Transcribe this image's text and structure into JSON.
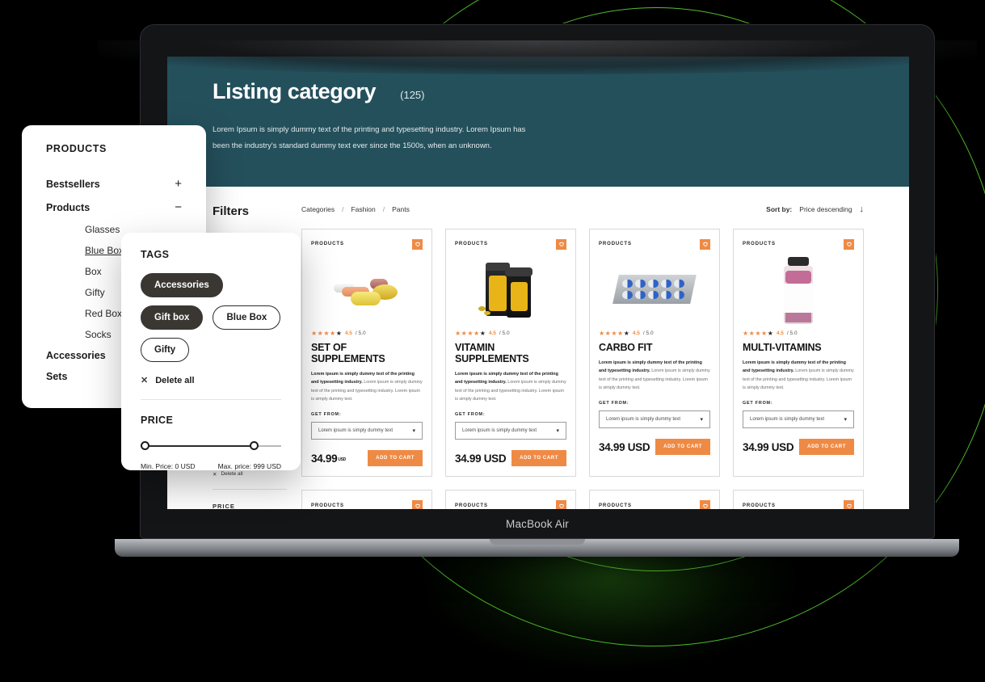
{
  "device": {
    "model_label": "MacBook Air"
  },
  "hero": {
    "title": "Listing category",
    "count": "(125)",
    "description_line1": "Lorem Ipsum is simply dummy text of the printing and typesetting industry. Lorem Ipsum has",
    "description_line2": "been the industry's standard dummy text ever since the 1500s, when an unknown.",
    "bg_color": "#24505c"
  },
  "filters_column": {
    "title": "Filters",
    "section_label": "PRODUCTS",
    "ghost_delete_all": "Delete all",
    "ghost_price_label": "PRICE"
  },
  "toolbar": {
    "breadcrumbs": [
      "Categories",
      "Fashion",
      "Pants"
    ],
    "separator": "/",
    "sort_label": "Sort by:",
    "sort_value": "Price descending",
    "sort_direction_icon": "↓"
  },
  "products_panel": {
    "title": "PRODUCTS",
    "items": [
      {
        "label": "Bestsellers",
        "sign": "+",
        "level": "top"
      },
      {
        "label": "Products",
        "sign": "−",
        "level": "top"
      },
      {
        "label": "Glasses",
        "level": "sub"
      },
      {
        "label": "Blue Box",
        "level": "sub",
        "active": true
      },
      {
        "label": "Box",
        "level": "sub"
      },
      {
        "label": "Gifty",
        "level": "sub"
      },
      {
        "label": "Red Box",
        "level": "sub"
      },
      {
        "label": "Socks",
        "level": "sub"
      },
      {
        "label": "Accessories",
        "level": "top"
      },
      {
        "label": "Sets",
        "level": "top"
      }
    ]
  },
  "tags_panel": {
    "title": "TAGS",
    "chips": [
      {
        "label": "Accessories",
        "selected": true
      },
      {
        "label": "Gift box",
        "selected": true
      },
      {
        "label": "Blue Box",
        "selected": false
      },
      {
        "label": "Gifty",
        "selected": false
      }
    ],
    "delete_all": "Delete all",
    "price_title": "PRICE",
    "min_price_label": "Min. Price: 0 USD",
    "max_price_label": "Max. price: 999 USD",
    "min_value": 0,
    "max_value": 999
  },
  "cards": {
    "kicker": "PRODUCTS",
    "rating_value": "4.5",
    "rating_max": "/ 5.0",
    "stars_filled": 4,
    "stars_dark": 1,
    "desc_bold": "Lorem ipsum is simply dummy text of the printing and typesetting industry.",
    "desc_rest": " Lorem ipsum is simply dummy text of the printing and typesetting industry. Lorem ipsum is simply dummy text.",
    "select_label": "GET FROM:",
    "select_value": "Lorem ipsum is simply dummy text",
    "chevron": "⌄",
    "add_to_cart": "ADD TO CART",
    "accent_color": "#ef8a45"
  },
  "products": [
    {
      "title": "SET OF SUPPLEMENTS",
      "price": "34.99",
      "currency": "USD",
      "currency_small": true,
      "art": "pills"
    },
    {
      "title": "VITAMIN SUPPLEMENTS",
      "price": "34.99",
      "currency": "USD",
      "currency_small": false,
      "art": "jars"
    },
    {
      "title": "CARBO FIT",
      "price": "34.99",
      "currency": "USD",
      "currency_small": false,
      "art": "blister"
    },
    {
      "title": "MULTI-VITAMINS",
      "price": "34.99",
      "currency": "USD",
      "currency_small": false,
      "art": "bottle"
    }
  ],
  "products_row2": [
    {
      "art": "pills"
    },
    {
      "art": "jars"
    },
    {
      "art": "blister"
    },
    {
      "art": "bottle"
    }
  ],
  "theme": {
    "background": "#000000",
    "deco_circle_color": "#5ec832",
    "teal": "#24505c",
    "orange": "#ef8a45"
  }
}
